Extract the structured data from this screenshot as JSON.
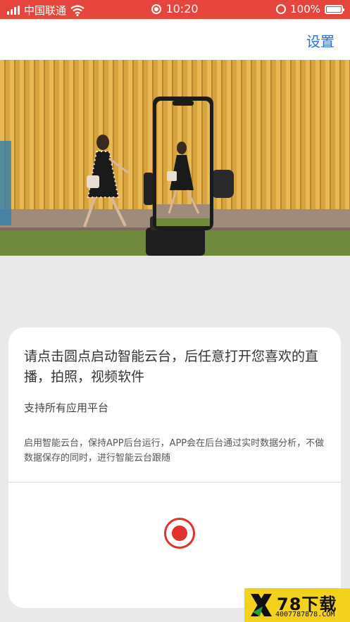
{
  "status_bar": {
    "carrier": "中国联通",
    "time": "10:20",
    "battery": "100%"
  },
  "nav": {
    "settings_label": "设置"
  },
  "hero": {
    "image_desc_icon": "phone-gimbal-image"
  },
  "card": {
    "title": "请点击圆点启动智能云台，后任意打开您喜欢的直播，拍照，视频软件",
    "subtitle": "支持所有应用平台",
    "description": "启用智能云台，保持APP后台运行，APP会在后台通过实时数据分析，不做数据保存的同时，进行智能云台跟随"
  },
  "watermark": {
    "text": "78下载",
    "url": "4007787878.COM"
  },
  "colors": {
    "status_bar": "#e5453b",
    "accent": "#2a6fd6",
    "record": "#e0312b"
  }
}
